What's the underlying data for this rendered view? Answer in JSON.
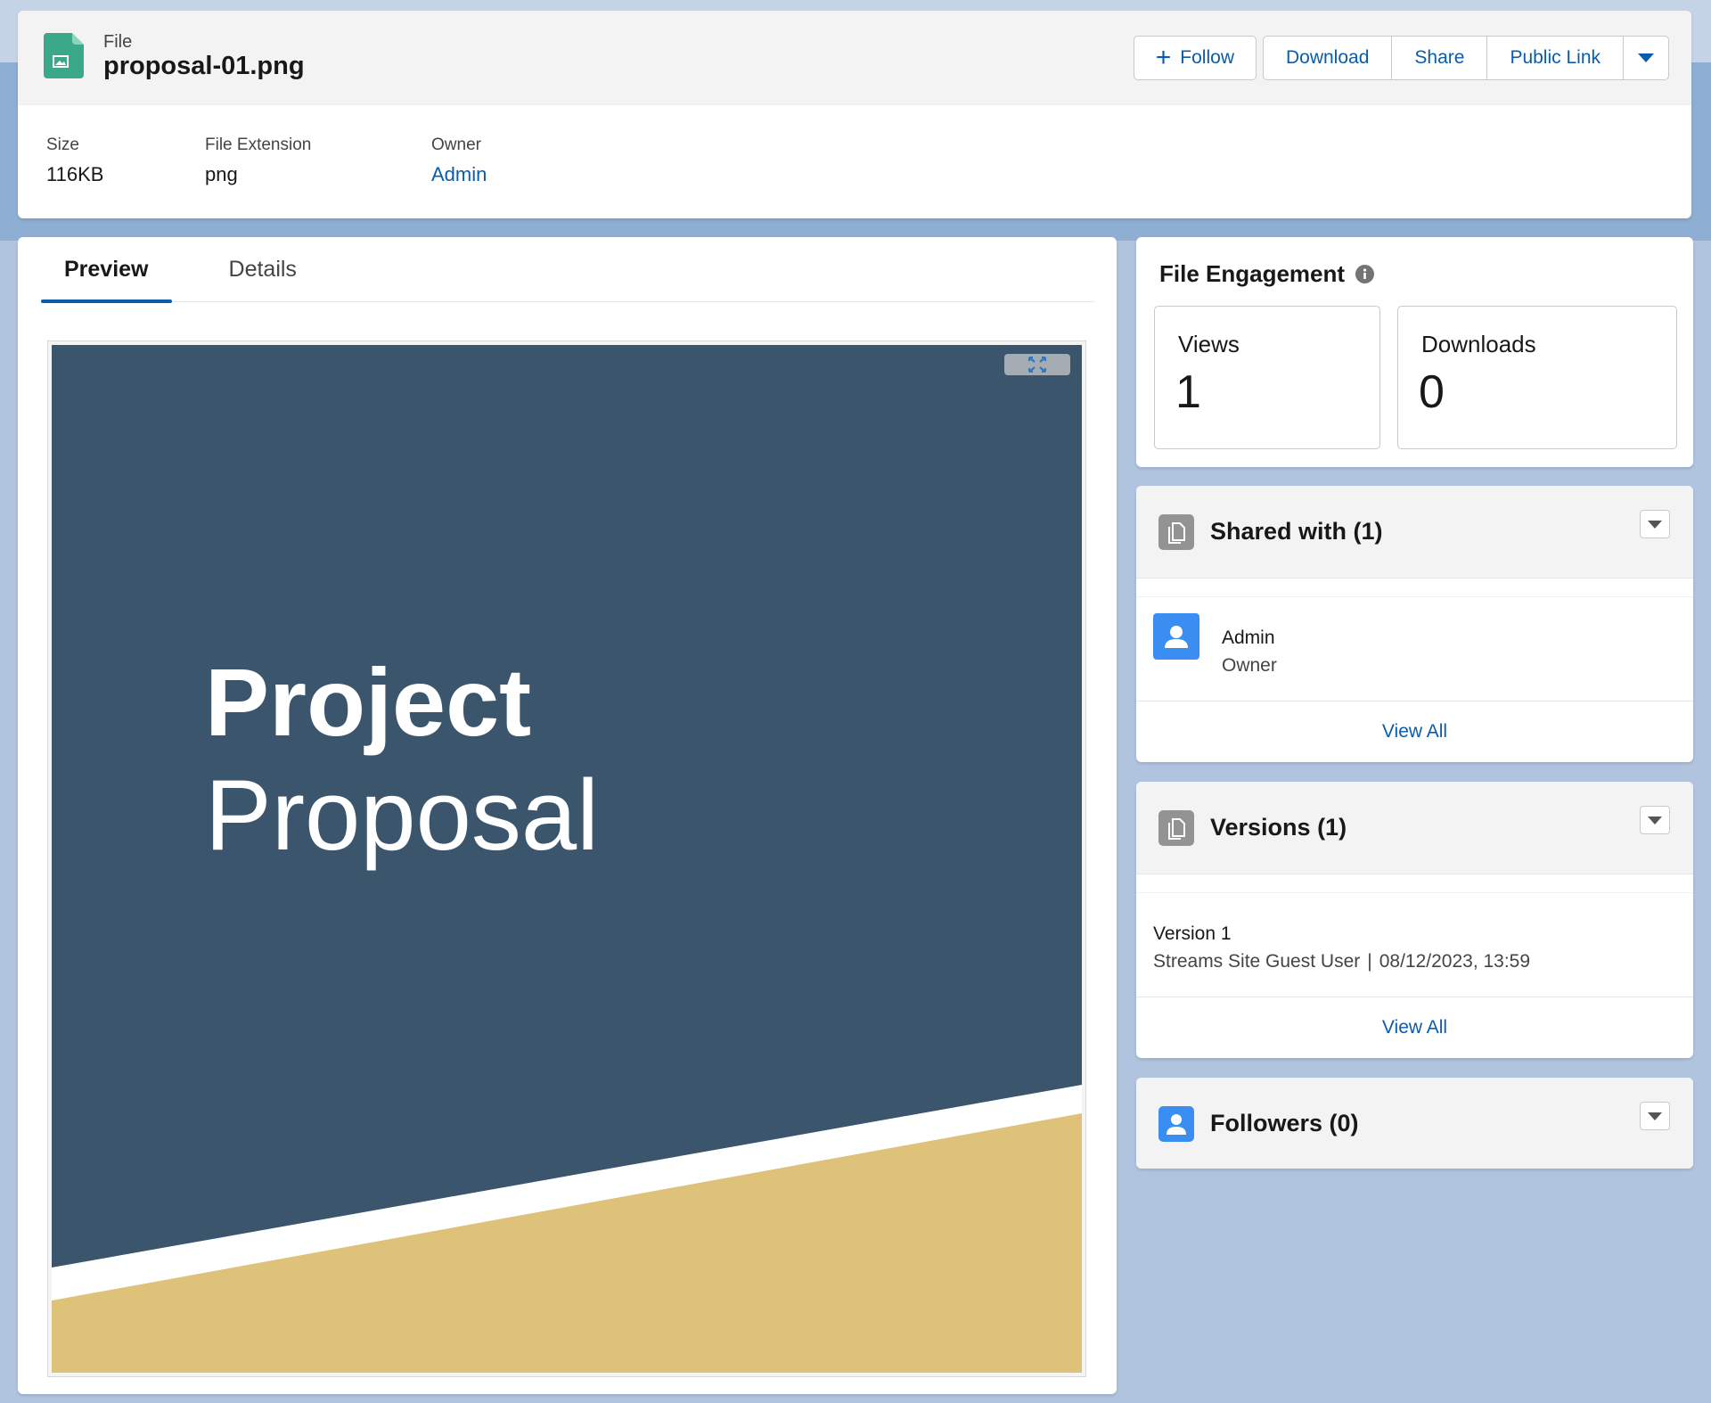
{
  "colors": {
    "brand_blue": "#0b5cab",
    "file_icon": "#3ba88a",
    "avatar_blue": "#3a8ef2",
    "related_icon_gray": "#939393",
    "preview_navy": "#3b566c",
    "preview_gold": "#dfc279"
  },
  "header": {
    "record_type": "File",
    "title": "proposal-01.png",
    "icon": "image-file-icon",
    "actions": {
      "follow": "Follow",
      "download": "Download",
      "share": "Share",
      "public_link": "Public Link",
      "more_icon": "chevron-down-icon"
    },
    "fields": [
      {
        "label": "Size",
        "value": "116KB"
      },
      {
        "label": "File Extension",
        "value": "png"
      },
      {
        "label": "Owner",
        "value": "Admin"
      }
    ]
  },
  "tabs": [
    {
      "label": "Preview",
      "active": true
    },
    {
      "label": "Details",
      "active": false
    }
  ],
  "preview": {
    "line1": "Project",
    "line2": "Proposal",
    "expand_icon": "expand-icon"
  },
  "engagement": {
    "title": "File Engagement",
    "info_icon": "info-icon",
    "views_label": "Views",
    "views_value": "1",
    "downloads_label": "Downloads",
    "downloads_value": "0"
  },
  "shared": {
    "title": "Shared with (1)",
    "items": [
      {
        "name": "Admin",
        "role": "Owner"
      }
    ],
    "view_all": "View All"
  },
  "versions": {
    "title": "Versions (1)",
    "items": [
      {
        "name": "Version 1",
        "user": "Streams Site Guest User",
        "separator": "|",
        "date": "08/12/2023, 13:59"
      }
    ],
    "view_all": "View All"
  },
  "followers": {
    "title": "Followers (0)"
  }
}
